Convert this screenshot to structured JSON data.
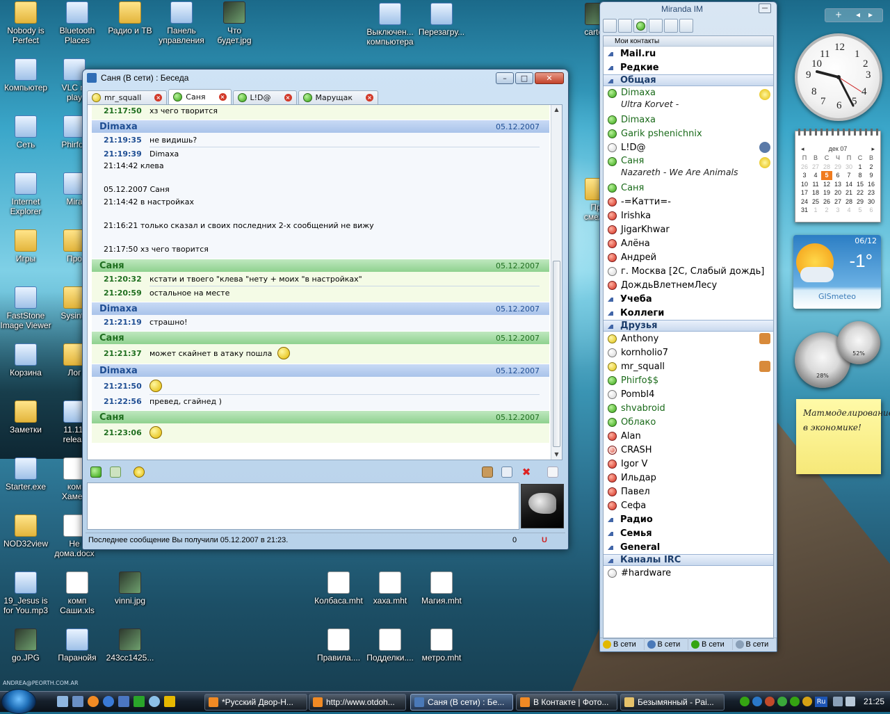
{
  "desktop": {
    "icons": [
      {
        "label": "Nobody is\nPerfect"
      },
      {
        "label": "Bluetooth\nPlaces"
      },
      {
        "label": "Радио и ТВ"
      },
      {
        "label": "Панель\nуправления"
      },
      {
        "label": "Что\nбудет.jpg"
      },
      {
        "label": "Выключен...\nкомпьютера"
      },
      {
        "label": "Перезагру..."
      },
      {
        "label": "cartoo"
      },
      {
        "label": "Компьютер"
      },
      {
        "label": "VLC m\nplay"
      },
      {
        "label": "Сеть"
      },
      {
        "label": "Phirfos"
      },
      {
        "label": "Internet\nExplorer"
      },
      {
        "label": "Mira"
      },
      {
        "label": "Игры"
      },
      {
        "label": "Про"
      },
      {
        "label": "FastStone\nImage Viewer"
      },
      {
        "label": "Sysinte"
      },
      {
        "label": "Корзина"
      },
      {
        "label": "Лог"
      },
      {
        "label": "Заметки"
      },
      {
        "label": "11.11.\nreleas"
      },
      {
        "label": "Starter.exe"
      },
      {
        "label": "ком\nХамел"
      },
      {
        "label": "NOD32view"
      },
      {
        "label": "Не\nдома.docx"
      },
      {
        "label": "19_Jesus is\nfor You.mp3"
      },
      {
        "label": "комп\nСаши.xls"
      },
      {
        "label": "vinni.jpg"
      },
      {
        "label": "Колбаса.mht"
      },
      {
        "label": "хаха.mht"
      },
      {
        "label": "Магия.mht"
      },
      {
        "label": "go.JPG"
      },
      {
        "label": "Паранойя"
      },
      {
        "label": "243cc1425..."
      },
      {
        "label": "Правила...."
      },
      {
        "label": "Подделки...."
      },
      {
        "label": "метро.mht"
      },
      {
        "label": "Пр\nсмело"
      }
    ],
    "watermark": "ANDREA@PEORTH.COM.AR"
  },
  "chat_window": {
    "title": "Саня (В сети) : Беседа",
    "tabs": [
      {
        "label": "mr_squall",
        "status": "yellow"
      },
      {
        "label": "Саня",
        "status": "green"
      },
      {
        "label": "L!D@",
        "status": "green"
      },
      {
        "label": "Марущак",
        "status": "green"
      }
    ],
    "messages": [
      {
        "type": "in",
        "partial": true,
        "lines": [
          {
            "time": "21:17:50",
            "text": "хз чего творится"
          }
        ]
      },
      {
        "type": "out",
        "author": "Dimaxa",
        "date": "05.12.2007",
        "lines": [
          {
            "time": "21:19:35",
            "text": "не видишь?"
          },
          {
            "time": "21:19:39",
            "text": "Dimaxa"
          }
        ],
        "quote": [
          "21:14:42 клева",
          "",
          "05.12.2007 Саня",
          "21:14:42 в настройках",
          "",
          "21:16:21 только сказал и своих последних 2-х сообщений не вижу",
          "",
          "21:17:50 хз чего творится"
        ]
      },
      {
        "type": "in",
        "author": "Саня",
        "date": "05.12.2007",
        "lines": [
          {
            "time": "21:20:32",
            "text": "кстати и твоего \"клева \"нету + моих \"в настройках\""
          },
          {
            "time": "21:20:59",
            "text": "остальное на месте"
          }
        ]
      },
      {
        "type": "out",
        "author": "Dimaxa",
        "date": "05.12.2007",
        "lines": [
          {
            "time": "21:21:19",
            "text": "страшно!"
          }
        ]
      },
      {
        "type": "in",
        "author": "Саня",
        "date": "05.12.2007",
        "lines": [
          {
            "time": "21:21:37",
            "text": "может скайнет в атаку пошла",
            "smiley": true
          }
        ]
      },
      {
        "type": "out",
        "author": "Dimaxa",
        "date": "05.12.2007",
        "lines": [
          {
            "time": "21:21:50",
            "text": "",
            "smiley": true
          },
          {
            "time": "21:22:56",
            "text": "превед, сгайнед )"
          }
        ]
      },
      {
        "type": "in",
        "author": "Саня",
        "date": "05.12.2007",
        "lines": [
          {
            "time": "21:23:06",
            "text": "",
            "smiley": true
          }
        ]
      }
    ],
    "status_text": "Последнее сообщение Вы получили 05.12.2007 в 21:23.",
    "char_count": "0",
    "u_mark": "U"
  },
  "miranda": {
    "title": "Miranda IM",
    "header": "Мои контакты",
    "rows": [
      {
        "kind": "group",
        "label": "Mail.ru"
      },
      {
        "kind": "group",
        "label": "Редкие"
      },
      {
        "kind": "group-open",
        "label": "Общая"
      },
      {
        "kind": "contact2",
        "label": "Dimaxa",
        "sub": "Ultra Korvet -",
        "status": "green"
      },
      {
        "kind": "contact",
        "label": "Dimaxa",
        "status": "green"
      },
      {
        "kind": "contact",
        "label": "Garik pshenichnix",
        "status": "green"
      },
      {
        "kind": "contact",
        "label": "L!D@",
        "status": "gray"
      },
      {
        "kind": "contact2",
        "label": "Саня",
        "sub": "Nazareth - We Are Animals",
        "status": "green"
      },
      {
        "kind": "contact",
        "label": "Саня",
        "status": "green"
      },
      {
        "kind": "contact",
        "label": "-=Катти=-",
        "status": "red"
      },
      {
        "kind": "contact",
        "label": "Irishka",
        "status": "red"
      },
      {
        "kind": "contact",
        "label": "JigarKhwar",
        "status": "red"
      },
      {
        "kind": "contact",
        "label": "Алёна",
        "status": "red"
      },
      {
        "kind": "contact",
        "label": "Андрей",
        "status": "red"
      },
      {
        "kind": "contact",
        "label": "г. Москва  [2C, Слабый дождь]",
        "status": "gray"
      },
      {
        "kind": "contact",
        "label": "ДождьВлетнемЛесу",
        "status": "red"
      },
      {
        "kind": "group",
        "label": "Учеба"
      },
      {
        "kind": "group",
        "label": "Коллеги"
      },
      {
        "kind": "group-open",
        "label": "Друзья"
      },
      {
        "kind": "contact",
        "label": "Anthony",
        "status": "yellow"
      },
      {
        "kind": "contact",
        "label": "kornholio7",
        "status": "gray"
      },
      {
        "kind": "contact",
        "label": "mr_squall",
        "status": "yellow"
      },
      {
        "kind": "contact",
        "label": "Phirfo$$",
        "status": "green"
      },
      {
        "kind": "contact",
        "label": "PombI4",
        "status": "gray"
      },
      {
        "kind": "contact",
        "label": "shvabroid",
        "status": "green"
      },
      {
        "kind": "contact",
        "label": "Облако",
        "status": "green"
      },
      {
        "kind": "contact",
        "label": "Alan",
        "status": "red"
      },
      {
        "kind": "contact",
        "label": "CRASH",
        "status": "dnd"
      },
      {
        "kind": "contact",
        "label": "Igor V",
        "status": "red"
      },
      {
        "kind": "contact",
        "label": "Ильдар",
        "status": "red"
      },
      {
        "kind": "contact",
        "label": "Павел",
        "status": "red"
      },
      {
        "kind": "contact",
        "label": "Сефа",
        "status": "red"
      },
      {
        "kind": "group",
        "label": "Радио"
      },
      {
        "kind": "group",
        "label": "Семья"
      },
      {
        "kind": "group",
        "label": "General"
      },
      {
        "kind": "group-open",
        "label": "Каналы IRC"
      },
      {
        "kind": "contact",
        "label": "#hardware",
        "status": "gray"
      }
    ],
    "statusbar": [
      "В сети",
      "В сети",
      "В сети",
      "В сети"
    ]
  },
  "gadgets": {
    "calendar": {
      "month": "дек 07",
      "weekdays": [
        "П",
        "В",
        "С",
        "Ч",
        "П",
        "С",
        "В"
      ],
      "weeks": [
        [
          "26",
          "27",
          "28",
          "29",
          "30",
          "1",
          "2"
        ],
        [
          "3",
          "4",
          "5",
          "6",
          "7",
          "8",
          "9"
        ],
        [
          "10",
          "11",
          "12",
          "13",
          "14",
          "15",
          "16"
        ],
        [
          "17",
          "18",
          "19",
          "20",
          "21",
          "22",
          "23"
        ],
        [
          "24",
          "25",
          "26",
          "27",
          "28",
          "29",
          "30"
        ],
        [
          "31",
          "1",
          "2",
          "3",
          "4",
          "5",
          "6"
        ]
      ],
      "today": "5"
    },
    "weather": {
      "date": "06/12",
      "temp": "-1°",
      "brand": "GISmeteo"
    },
    "meter": {
      "cpu": "28%",
      "mem": "52%"
    },
    "note": "Матмоделирование в экономике!"
  },
  "taskbar": {
    "buttons": [
      "*Русский Двор-Н...",
      "http://www.otdoh...",
      "Саня (В сети) : Бе...",
      "В Контакте | Фото...",
      "Безымянный - Pai..."
    ],
    "lang": "Ru",
    "clock": "21:25"
  },
  "colors": {
    "online": "#35a412",
    "away": "#e0c213",
    "offline": "#d22c1c",
    "out_header": "#a9c3ea",
    "in_header": "#8fd18f"
  }
}
